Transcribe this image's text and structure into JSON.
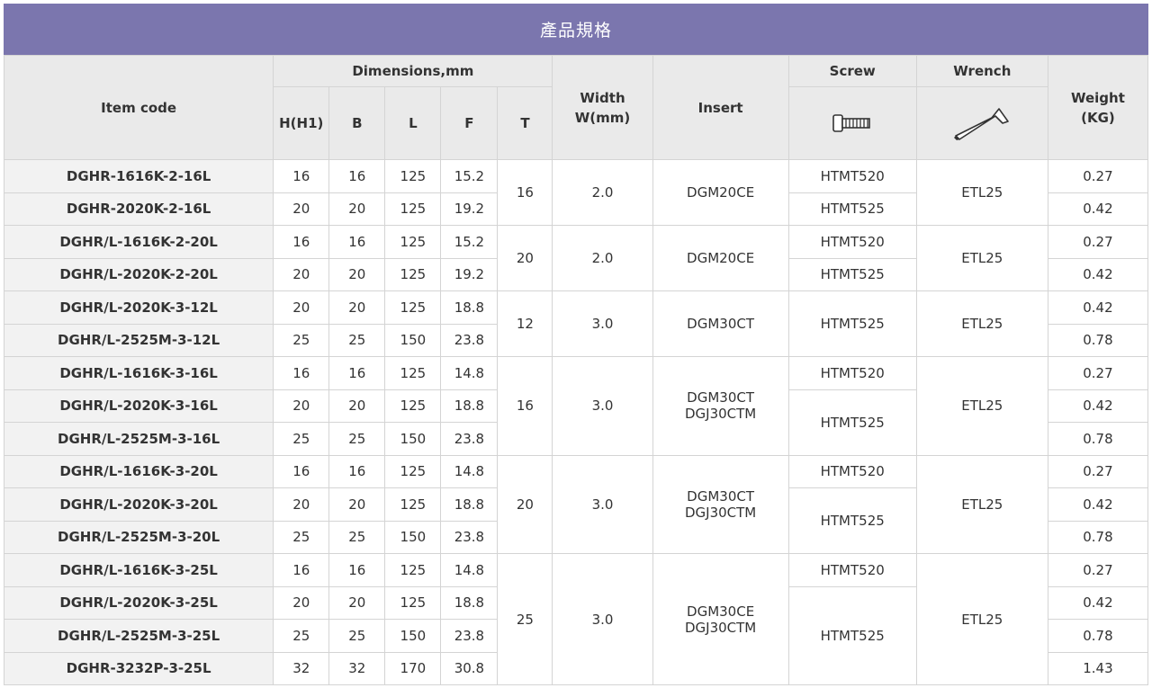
{
  "title": "產品規格",
  "headers": {
    "item_code": "Item code",
    "dimensions": "Dimensions,mm",
    "h": "H(H1)",
    "b": "B",
    "l": "L",
    "f": "F",
    "t": "T",
    "width": "Width\nW(mm)",
    "insert": "Insert",
    "screw": "Screw",
    "wrench": "Wrench",
    "weight": "Weight\n(KG)",
    "screw_icon": "screw-icon",
    "wrench_icon": "wrench-icon"
  },
  "rows": [
    {
      "code": "DGHR-1616K-2-16L",
      "h": "16",
      "b": "16",
      "l": "125",
      "f": "15.2",
      "t": "16",
      "w": "2.0",
      "insert": "DGM20CE",
      "screw": "HTMT520",
      "wrench": "ETL25",
      "kg": "0.27"
    },
    {
      "code": "DGHR-2020K-2-16L",
      "h": "20",
      "b": "20",
      "l": "125",
      "f": "19.2",
      "screw": "HTMT525",
      "kg": "0.42"
    },
    {
      "code": "DGHR/L-1616K-2-20L",
      "h": "16",
      "b": "16",
      "l": "125",
      "f": "15.2",
      "t": "20",
      "w": "2.0",
      "insert": "DGM20CE",
      "screw": "HTMT520",
      "wrench": "ETL25",
      "kg": "0.27"
    },
    {
      "code": "DGHR/L-2020K-2-20L",
      "h": "20",
      "b": "20",
      "l": "125",
      "f": "19.2",
      "screw": "HTMT525",
      "kg": "0.42"
    },
    {
      "code": "DGHR/L-2020K-3-12L",
      "h": "20",
      "b": "20",
      "l": "125",
      "f": "18.8",
      "t": "12",
      "w": "3.0",
      "insert": "DGM30CT",
      "screw": "HTMT525",
      "wrench": "ETL25",
      "kg": "0.42"
    },
    {
      "code": "DGHR/L-2525M-3-12L",
      "h": "25",
      "b": "25",
      "l": "150",
      "f": "23.8",
      "kg": "0.78"
    },
    {
      "code": "DGHR/L-1616K-3-16L",
      "h": "16",
      "b": "16",
      "l": "125",
      "f": "14.8",
      "t": "16",
      "w": "3.0",
      "insert": "DGM30CT\nDGJ30CTM",
      "screw": "HTMT520",
      "wrench": "ETL25",
      "kg": "0.27"
    },
    {
      "code": "DGHR/L-2020K-3-16L",
      "h": "20",
      "b": "20",
      "l": "125",
      "f": "18.8",
      "screw": "HTMT525",
      "kg": "0.42"
    },
    {
      "code": "DGHR/L-2525M-3-16L",
      "h": "25",
      "b": "25",
      "l": "150",
      "f": "23.8",
      "kg": "0.78"
    },
    {
      "code": "DGHR/L-1616K-3-20L",
      "h": "16",
      "b": "16",
      "l": "125",
      "f": "14.8",
      "t": "20",
      "w": "3.0",
      "insert": "DGM30CT\nDGJ30CTM",
      "screw": "HTMT520",
      "wrench": "ETL25",
      "kg": "0.27"
    },
    {
      "code": "DGHR/L-2020K-3-20L",
      "h": "20",
      "b": "20",
      "l": "125",
      "f": "18.8",
      "screw": "HTMT525",
      "kg": "0.42"
    },
    {
      "code": "DGHR/L-2525M-3-20L",
      "h": "25",
      "b": "25",
      "l": "150",
      "f": "23.8",
      "kg": "0.78"
    },
    {
      "code": "DGHR/L-1616K-3-25L",
      "h": "16",
      "b": "16",
      "l": "125",
      "f": "14.8",
      "t": "25",
      "w": "3.0",
      "insert": "DGM30CE\nDGJ30CTM",
      "screw": "HTMT520",
      "wrench": "ETL25",
      "kg": "0.27"
    },
    {
      "code": "DGHR/L-2020K-3-25L",
      "h": "20",
      "b": "20",
      "l": "125",
      "f": "18.8",
      "screw": "HTMT525",
      "kg": "0.42"
    },
    {
      "code": "DGHR/L-2525M-3-25L",
      "h": "25",
      "b": "25",
      "l": "150",
      "f": "23.8",
      "kg": "0.78"
    },
    {
      "code": "DGHR-3232P-3-25L",
      "h": "32",
      "b": "32",
      "l": "170",
      "f": "30.8",
      "kg": "1.43"
    }
  ],
  "colors": {
    "title_bg": "#7b76ae",
    "header_bg": "#eaeaea",
    "code_bg": "#f2f2f2",
    "border": "#d4d4d4"
  }
}
